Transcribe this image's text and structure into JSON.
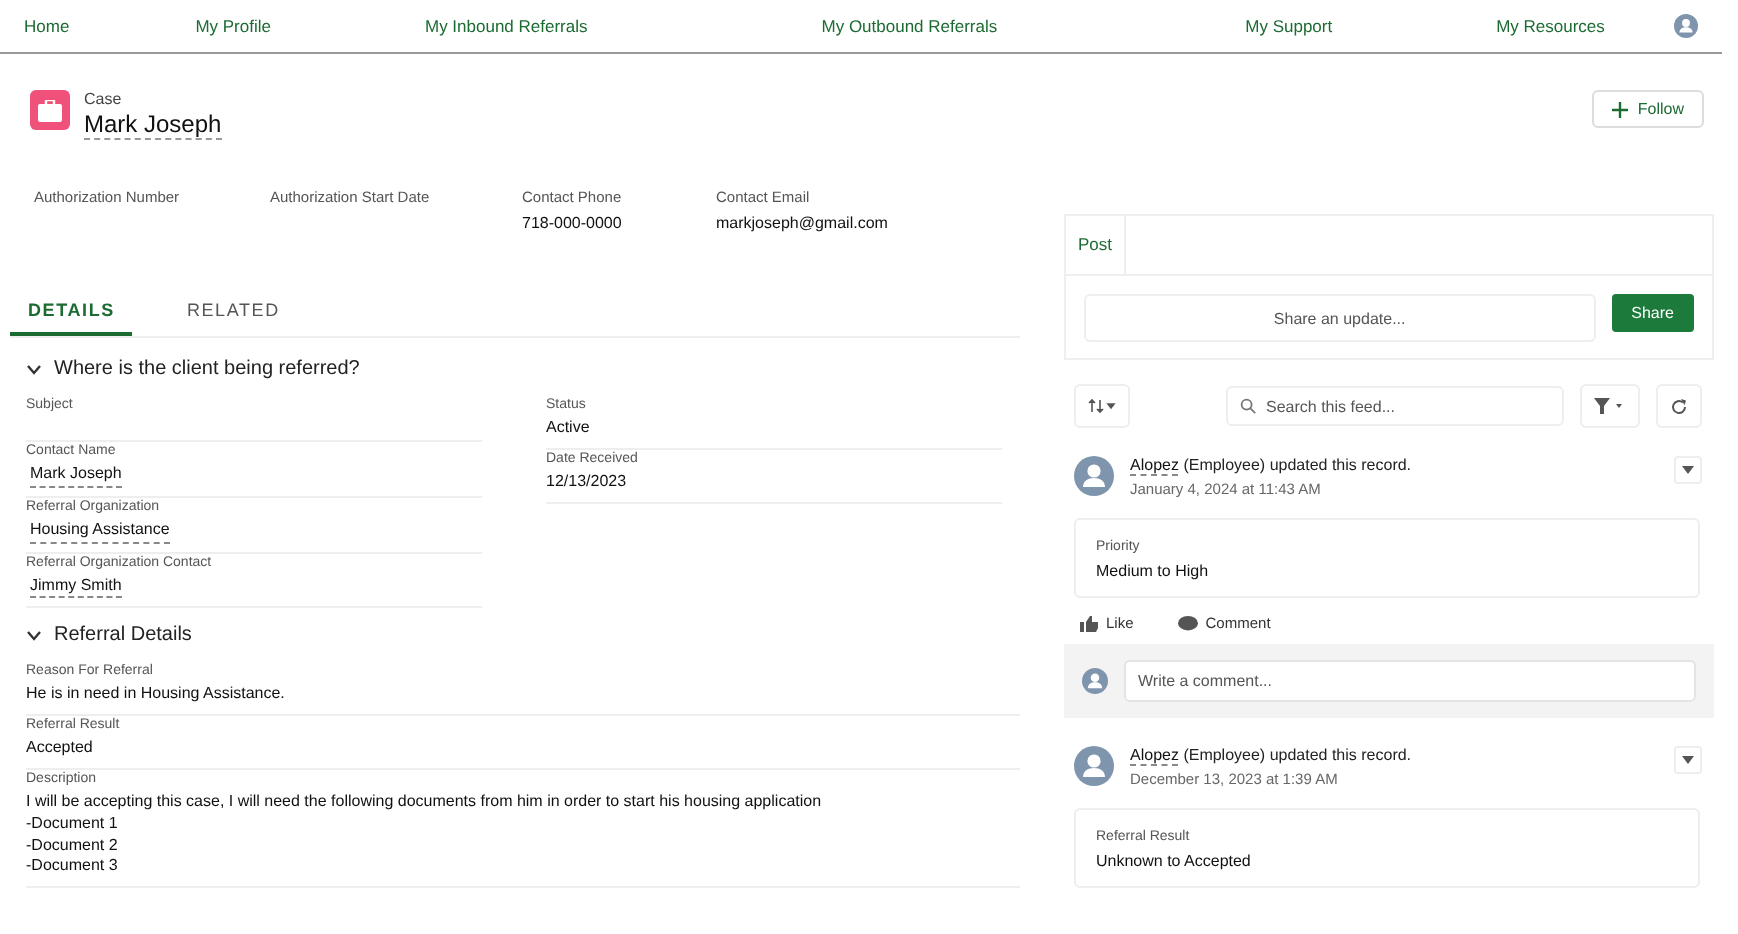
{
  "nav": {
    "items": [
      {
        "label": "Home"
      },
      {
        "label": "My Profile"
      },
      {
        "label": "My Inbound Referrals"
      },
      {
        "label": "My Outbound Referrals"
      },
      {
        "label": "My Support"
      },
      {
        "label": "My Resources"
      }
    ]
  },
  "record": {
    "type_label": "Case",
    "name": "Mark Joseph",
    "follow_button": "Follow"
  },
  "highlights": [
    {
      "label": "Authorization Number"
    },
    {
      "label": "Authorization Start Date"
    },
    {
      "label": "Contact Phone",
      "value": "718-000-0000"
    },
    {
      "label": "Contact Email",
      "value": "markjoseph@gmail.com"
    }
  ],
  "tabs": [
    {
      "label": "DETAILS",
      "selected": true
    },
    {
      "label": "RELATED",
      "selected": false
    }
  ],
  "sections": [
    {
      "title": "Where is the client being referred?",
      "expanded": true,
      "columns": [
        [
          {
            "label": "Subject",
            "kind": "text"
          },
          {
            "label": "Contact Name",
            "value": "Mark Joseph",
            "kind": "link"
          },
          {
            "label": "Referral Organization",
            "value": "Housing Assistance",
            "kind": "link"
          },
          {
            "label": "Referral Organization Contact",
            "value": "Jimmy Smith",
            "kind": "link"
          }
        ],
        [
          {
            "label": "Status",
            "value": "Active",
            "kind": "text"
          },
          {
            "label": "Date Received",
            "value": "12/13/2023",
            "kind": "text"
          }
        ]
      ]
    },
    {
      "title": "Referral Details",
      "expanded": true,
      "columns": [
        [
          {
            "label": "Reason For Referral",
            "value": "He is in need in Housing Assistance.",
            "kind": "text"
          },
          {
            "label": "Referral Result",
            "value": "Accepted",
            "kind": "text"
          },
          {
            "label": "Description",
            "value": "I will be accepting this case, I will need the following documents from him in order to start his housing application\n-Document 1\n-Document 2\n-Document 3",
            "kind": "text"
          }
        ]
      ]
    }
  ],
  "feed": {
    "publisher_tab": "Post",
    "share_placeholder": "Share an update...",
    "share_button": "Share",
    "search_placeholder": "Search this feed...",
    "posts": [
      {
        "author": "Alopez",
        "action": "(Employee) updated this record.",
        "date": "January 4, 2024 at 11:43 AM",
        "change_label": "Priority",
        "change_value": "Medium to High",
        "like": "Like",
        "comment": "Comment",
        "comment_placeholder": "Write a comment..."
      },
      {
        "author": "Alopez",
        "action": "(Employee) updated this record.",
        "date": "December 13, 2023 at 1:39 AM",
        "change_label": "Referral Result",
        "change_value": "Unknown to Accepted"
      }
    ]
  }
}
